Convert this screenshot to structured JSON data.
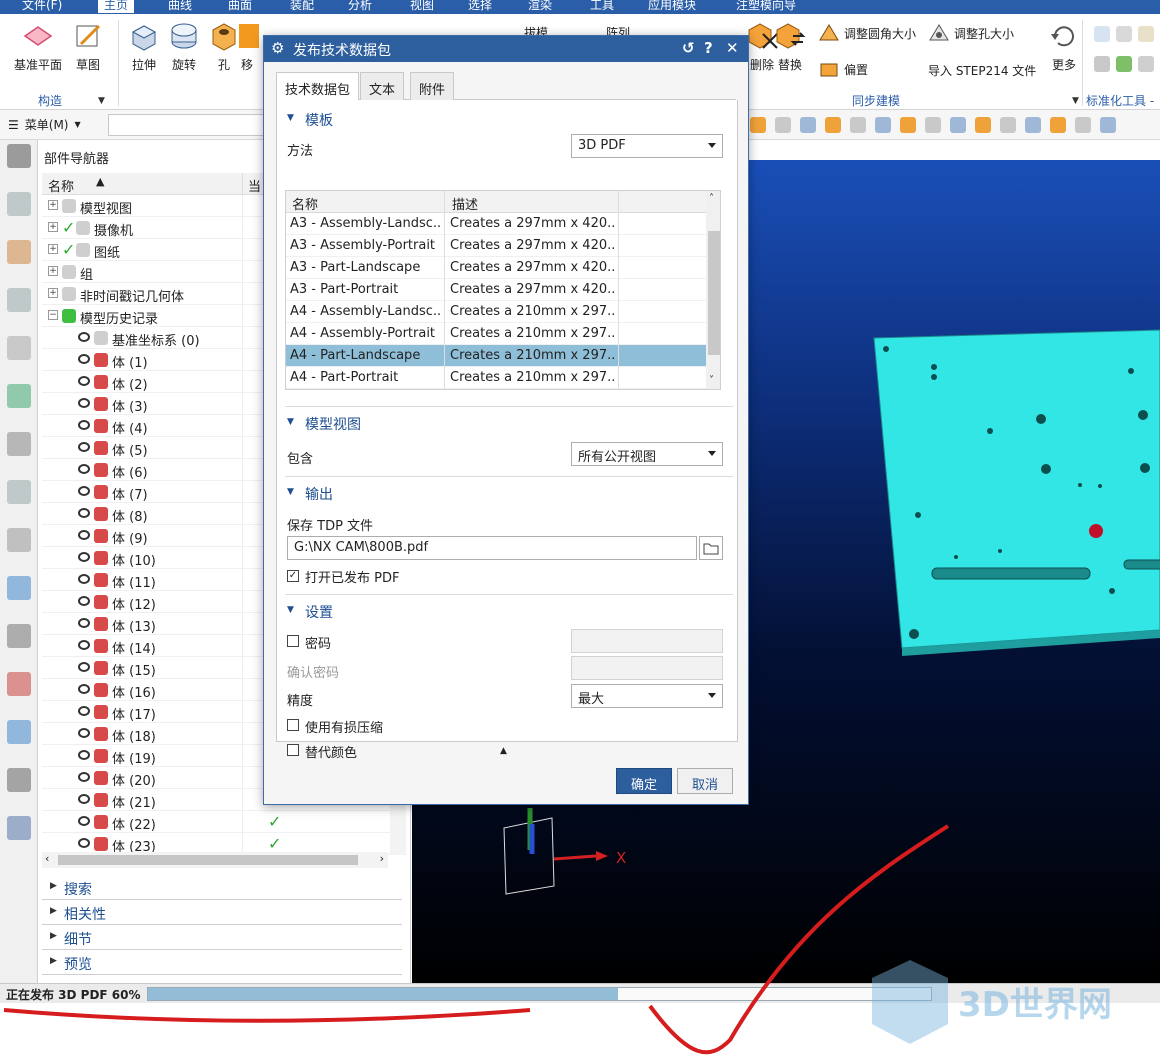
{
  "ribbon": {
    "tabs": [
      "文件(F)",
      "主页",
      "曲线",
      "曲面",
      "装配",
      "分析",
      "视图",
      "选择",
      "渲染",
      "工具",
      "应用模块",
      "注塑模向导"
    ],
    "buttons": [
      {
        "label": "基准平面"
      },
      {
        "label": "草图"
      },
      {
        "label": "拉伸"
      },
      {
        "label": "旋转"
      },
      {
        "label": "孔"
      },
      {
        "label": "移"
      },
      {
        "label": "拔模"
      },
      {
        "label": "阵列"
      },
      {
        "label": "删除"
      },
      {
        "label": "替换"
      },
      {
        "label": "更多"
      }
    ],
    "small_buttons": {
      "fillet_size": "调整圆角大小",
      "hole_size": "调整孔大小",
      "offset": "偏置",
      "import_step": "导入 STEP214 文件"
    },
    "groups": {
      "construct": "构造",
      "sync": "同步建模",
      "std": "标准化工具 -"
    }
  },
  "menubar": {
    "menu_label": "菜单(M)"
  },
  "navigator": {
    "title": "部件导航器",
    "col_name": "名称",
    "col_current": "当",
    "rows": [
      {
        "label": "模型视图",
        "indent": 0,
        "expander": "+",
        "icon": "model-views-icon"
      },
      {
        "label": "摄像机",
        "indent": 0,
        "expander": "+",
        "icon": "camera-icon",
        "checked": true
      },
      {
        "label": "图纸",
        "indent": 0,
        "expander": "+",
        "icon": "drawing-icon",
        "checked": true
      },
      {
        "label": "组",
        "indent": 0,
        "expander": "+",
        "icon": "group-icon"
      },
      {
        "label": "非时间戳记几何体",
        "indent": 0,
        "expander": "+",
        "icon": "folder-icon"
      },
      {
        "label": "模型历史记录",
        "indent": 0,
        "expander": "−",
        "icon": "history-icon"
      },
      {
        "label": "基准坐标系 (0)",
        "indent": 1,
        "icon": "datum-csys-icon"
      },
      {
        "label": "体 (1)",
        "indent": 1,
        "icon": "body-icon"
      },
      {
        "label": "体 (2)",
        "indent": 1,
        "icon": "body-icon"
      },
      {
        "label": "体 (3)",
        "indent": 1,
        "icon": "body-icon"
      },
      {
        "label": "体 (4)",
        "indent": 1,
        "icon": "body-icon"
      },
      {
        "label": "体 (5)",
        "indent": 1,
        "icon": "body-icon"
      },
      {
        "label": "体 (6)",
        "indent": 1,
        "icon": "body-icon"
      },
      {
        "label": "体 (7)",
        "indent": 1,
        "icon": "body-icon"
      },
      {
        "label": "体 (8)",
        "indent": 1,
        "icon": "body-icon"
      },
      {
        "label": "体 (9)",
        "indent": 1,
        "icon": "body-icon"
      },
      {
        "label": "体 (10)",
        "indent": 1,
        "icon": "body-icon"
      },
      {
        "label": "体 (11)",
        "indent": 1,
        "icon": "body-icon"
      },
      {
        "label": "体 (12)",
        "indent": 1,
        "icon": "body-icon"
      },
      {
        "label": "体 (13)",
        "indent": 1,
        "icon": "body-icon"
      },
      {
        "label": "体 (14)",
        "indent": 1,
        "icon": "body-icon"
      },
      {
        "label": "体 (15)",
        "indent": 1,
        "icon": "body-icon"
      },
      {
        "label": "体 (16)",
        "indent": 1,
        "icon": "body-icon"
      },
      {
        "label": "体 (17)",
        "indent": 1,
        "icon": "body-icon"
      },
      {
        "label": "体 (18)",
        "indent": 1,
        "icon": "body-icon"
      },
      {
        "label": "体 (19)",
        "indent": 1,
        "icon": "body-icon"
      },
      {
        "label": "体 (20)",
        "indent": 1,
        "icon": "body-icon"
      },
      {
        "label": "体 (21)",
        "indent": 1,
        "icon": "body-icon"
      },
      {
        "label": "体 (22)",
        "indent": 1,
        "icon": "body-icon",
        "current": true
      },
      {
        "label": "体 (23)",
        "indent": 1,
        "icon": "body-icon",
        "current": true
      }
    ],
    "sections": [
      "搜索",
      "相关性",
      "细节",
      "预览"
    ]
  },
  "dialog": {
    "title": "发布技术数据包",
    "tabs": [
      "技术数据包",
      "文本",
      "附件"
    ],
    "template_section": "模板",
    "method_label": "方法",
    "method_value": "3D PDF",
    "table_headers": [
      "名称",
      "描述"
    ],
    "templates": [
      {
        "name": "A3 - Assembly-Landsc...",
        "desc": "Creates a 297mm x 420..."
      },
      {
        "name": "A3 - Assembly-Portrait",
        "desc": "Creates a 297mm x 420..."
      },
      {
        "name": "A3 - Part-Landscape",
        "desc": "Creates a 297mm x 420..."
      },
      {
        "name": "A3 - Part-Portrait",
        "desc": "Creates a 297mm x 420..."
      },
      {
        "name": "A4 - Assembly-Landsc...",
        "desc": "Creates a 210mm x 297..."
      },
      {
        "name": "A4 - Assembly-Portrait",
        "desc": "Creates a 210mm x 297..."
      },
      {
        "name": "A4 - Part-Landscape",
        "desc": "Creates a 210mm x 297...",
        "selected": true
      },
      {
        "name": "A4 - Part-Portrait",
        "desc": "Creates a 210mm x 297..."
      }
    ],
    "model_view_section": "模型视图",
    "include_label": "包含",
    "include_value": "所有公开视图",
    "output_section": "输出",
    "save_tdp_label": "保存 TDP 文件",
    "save_path": "G:\\NX CAM\\800B.pdf",
    "open_pdf_label": "打开已发布 PDF",
    "open_pdf_checked": true,
    "settings_section": "设置",
    "password_label": "密码",
    "confirm_password_label": "确认密码",
    "precision_label": "精度",
    "precision_value": "最大",
    "lossy_label": "使用有损压缩",
    "alt_color_label": "替代颜色",
    "ok_label": "确定",
    "cancel_label": "取消"
  },
  "viewport": {
    "axis_x_label": "X"
  },
  "status": {
    "text": "正在发布 3D PDF 60%",
    "progress": 0.6
  },
  "watermark": "3D世界网",
  "colors": {
    "accent": "#2d5f9e",
    "part": "#33e6e6",
    "selection": "#8fbfd8",
    "annotation": "#d61c1c"
  }
}
